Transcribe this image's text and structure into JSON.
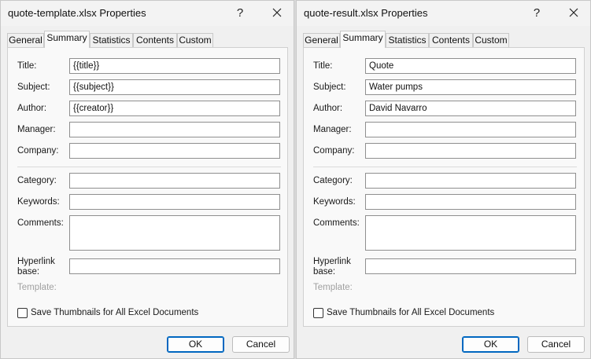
{
  "dialogs": [
    {
      "title": "quote-template.xlsx Properties",
      "help_label": "?",
      "tabs": [
        {
          "label": "General"
        },
        {
          "label": "Summary"
        },
        {
          "label": "Statistics"
        },
        {
          "label": "Contents"
        },
        {
          "label": "Custom"
        }
      ],
      "active_tab": "Summary",
      "fields": {
        "title": {
          "label": "Title:",
          "value": "{{title}}"
        },
        "subject": {
          "label": "Subject:",
          "value": "{{subject}}"
        },
        "author": {
          "label": "Author:",
          "value": "{{creator}}"
        },
        "manager": {
          "label": "Manager:",
          "value": ""
        },
        "company": {
          "label": "Company:",
          "value": ""
        },
        "category": {
          "label": "Category:",
          "value": ""
        },
        "keywords": {
          "label": "Keywords:",
          "value": ""
        },
        "comments": {
          "label": "Comments:",
          "value": ""
        },
        "hyperlink_base": {
          "label_line1": "Hyperlink",
          "label_line2": "base:",
          "value": ""
        },
        "template": {
          "label": "Template:",
          "value": ""
        }
      },
      "save_thumbnails": {
        "label": "Save Thumbnails for All Excel Documents",
        "checked": false
      },
      "buttons": {
        "ok": "OK",
        "cancel": "Cancel"
      }
    },
    {
      "title": "quote-result.xlsx Properties",
      "help_label": "?",
      "tabs": [
        {
          "label": "General"
        },
        {
          "label": "Summary"
        },
        {
          "label": "Statistics"
        },
        {
          "label": "Contents"
        },
        {
          "label": "Custom"
        }
      ],
      "active_tab": "Summary",
      "fields": {
        "title": {
          "label": "Title:",
          "value": "Quote"
        },
        "subject": {
          "label": "Subject:",
          "value": "Water pumps"
        },
        "author": {
          "label": "Author:",
          "value": "David Navarro"
        },
        "manager": {
          "label": "Manager:",
          "value": ""
        },
        "company": {
          "label": "Company:",
          "value": ""
        },
        "category": {
          "label": "Category:",
          "value": ""
        },
        "keywords": {
          "label": "Keywords:",
          "value": ""
        },
        "comments": {
          "label": "Comments:",
          "value": ""
        },
        "hyperlink_base": {
          "label_line1": "Hyperlink",
          "label_line2": "base:",
          "value": ""
        },
        "template": {
          "label": "Template:",
          "value": ""
        }
      },
      "save_thumbnails": {
        "label": "Save Thumbnails for All Excel Documents",
        "checked": false
      },
      "buttons": {
        "ok": "OK",
        "cancel": "Cancel"
      }
    }
  ],
  "colors": {
    "accent": "#0067c0",
    "background": "#f0f0f0",
    "panel": "#f9f9f9",
    "disabled_text": "#a0a0a0"
  },
  "icons": {
    "close": "close-icon"
  }
}
